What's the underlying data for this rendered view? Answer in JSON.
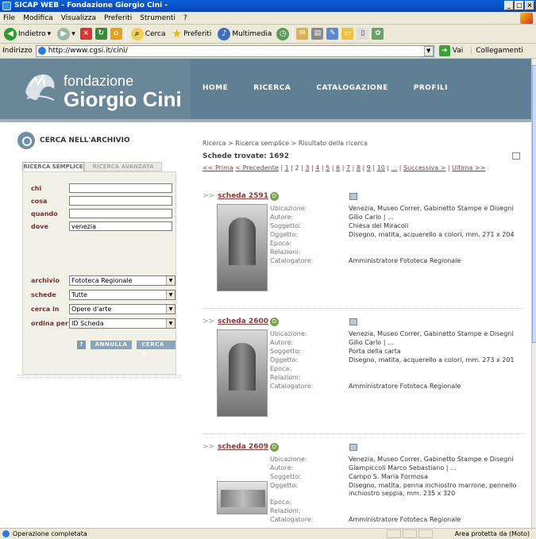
{
  "window": {
    "title": "SICAP WEB - Fondazione Giorgio Cini -"
  },
  "menu": [
    "File",
    "Modifica",
    "Visualizza",
    "Preferiti",
    "Strumenti",
    "?"
  ],
  "toolbar": {
    "back": "Indietro",
    "search": "Cerca",
    "favorites": "Preferiti",
    "media": "Multimedia"
  },
  "address": {
    "label": "Indirizzo",
    "url": "http://www.cgsi.it/cini/",
    "go": "Vai",
    "links": "Collegamenti"
  },
  "status": {
    "text": "Operazione completata",
    "zone": "Area protetta da (Moto)"
  },
  "site": {
    "logo_line1": "fondazione",
    "logo_line2": "Giorgio Cini",
    "nav": [
      "HOME",
      "RICERCA",
      "CATALOGAZIONE",
      "PROFILI"
    ]
  },
  "search_panel": {
    "title": "CERCA NELL'ARCHIVIO",
    "tab_simple": "RICERCA SEMPLICE",
    "tab_advanced": "RICERCA AVANZATA",
    "chi_label": "chi",
    "chi_value": "",
    "cosa_label": "cosa",
    "cosa_value": "",
    "quando_label": "quando",
    "quando_value": "",
    "dove_label": "dove",
    "dove_value": "venezia",
    "archivio_label": "archivio",
    "archivio_value": "Fototeca Regionale",
    "schede_label": "schede",
    "schede_value": "Tutte",
    "cercain_label": "cerca in",
    "cercain_value": "Opere d'arte",
    "ordina_label": "ordina per",
    "ordina_value": "ID Scheda",
    "help": "?",
    "cancel": "ANNULLA",
    "search": "CERCA >"
  },
  "results": {
    "breadcrumb": "Ricerca > Ricerca semplice > Risultato della ricerca",
    "count_label": "Schede trovate: 1692",
    "first": "<< Prima",
    "prev": "< Precedente",
    "pages": [
      "1",
      "2",
      "3",
      "4",
      "5",
      "6",
      "7",
      "8",
      "9",
      "10",
      "..."
    ],
    "next": "Successiva >",
    "last": "Ultima >>",
    "records": [
      {
        "title": "scheda 2591",
        "fields": [
          [
            "Ubicazione:",
            "Venezia, Museo Correr, Gabinetto Stampe e Disegni"
          ],
          [
            "Autore:",
            "Gilio Carlo | ..."
          ],
          [
            "Soggetto:",
            "Chiesa dei Miracoli"
          ],
          [
            "Oggetto:",
            "Disegno, matita, acquerello a colori, mm. 271 x 204"
          ],
          [
            "Epoca:",
            ""
          ],
          [
            "Relazioni:",
            ""
          ],
          [
            "Catalogatore:",
            "Amministratore Fototeca Regionale"
          ]
        ]
      },
      {
        "title": "scheda 2600",
        "fields": [
          [
            "Ubicazione:",
            "Venezia, Museo Correr, Gabinetto Stampe e Disegni"
          ],
          [
            "Autore:",
            "Gilio Carlo | ..."
          ],
          [
            "Soggetto:",
            "Porta della carta"
          ],
          [
            "Oggetto:",
            "Disegno, matita, acquerello a colori, mm. 273 x 201"
          ],
          [
            "Epoca:",
            ""
          ],
          [
            "Relazioni:",
            ""
          ],
          [
            "Catalogatore:",
            "Amministratore Fototeca Regionale"
          ]
        ]
      },
      {
        "title": "scheda 2609",
        "fields": [
          [
            "Ubicazione:",
            "Venezia, Museo Correr, Gabinetto Stampe e Disegni"
          ],
          [
            "Autore:",
            "Giampiccoli Marco Sebastiano | ..."
          ],
          [
            "Soggetto:",
            "Campo S. Maria Formosa"
          ],
          [
            "Oggetto:",
            "Disegno, matita, penna inchiostro marrone, pennello inchiostro seppia, mm. 235 x 320"
          ],
          [
            "Epoca:",
            ""
          ],
          [
            "Relazioni:",
            ""
          ],
          [
            "Catalogatore:",
            "Amministratore Fototeca Regionale"
          ]
        ]
      }
    ]
  }
}
